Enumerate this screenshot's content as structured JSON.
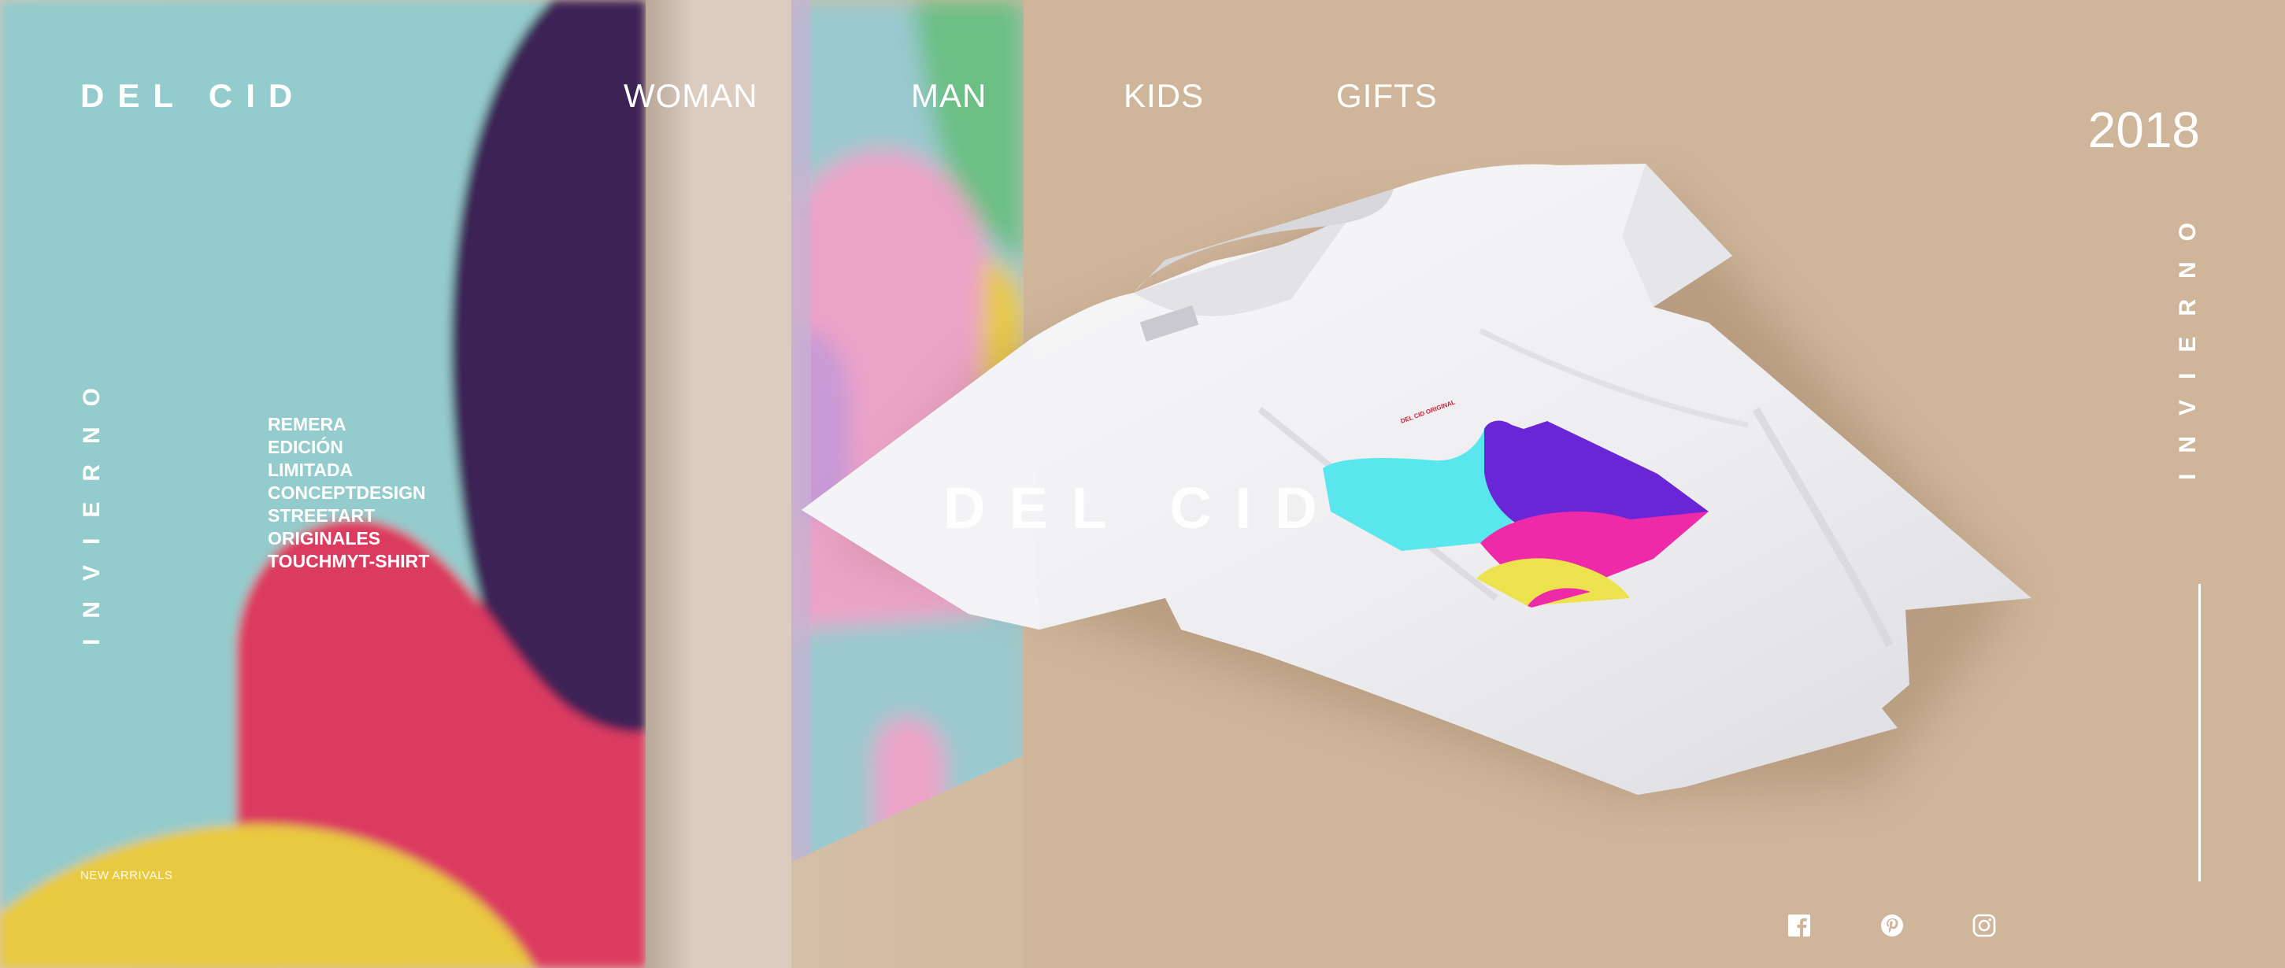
{
  "brand": {
    "logo_text": "DEL CID"
  },
  "nav": {
    "items": [
      {
        "label": "WOMAN"
      },
      {
        "label": "MAN"
      },
      {
        "label": "KIDS"
      },
      {
        "label": "GIFTS"
      }
    ]
  },
  "season": {
    "year": "2018",
    "vertical_left": "INVIERNO",
    "vertical_right": "INVIERNO"
  },
  "tags": [
    "REMERA",
    "EDICIÓN",
    "LIMITADA",
    "CONCEPTDESIGN",
    "STREETART",
    "ORIGINALES",
    "TOUCHMYT-SHIRT"
  ],
  "product": {
    "print_text": "DEL CID"
  },
  "footer": {
    "new_arrivals": "NEW ARRIVALS"
  },
  "social": [
    {
      "icon": "facebook-icon"
    },
    {
      "icon": "pinterest-icon"
    },
    {
      "icon": "instagram-icon"
    }
  ],
  "colors": {
    "background": "#cfb599",
    "canvas_teal": "#94cbcc",
    "canvas_purple": "#3c2456",
    "canvas_pink": "#dc3a60",
    "canvas_yellow": "#e8c940",
    "shirt": "#f1f1f3",
    "print_purple": "#6a26d6",
    "print_magenta": "#ef2aa8",
    "print_cyan": "#59e6ec",
    "print_yellow": "#ece24e"
  }
}
